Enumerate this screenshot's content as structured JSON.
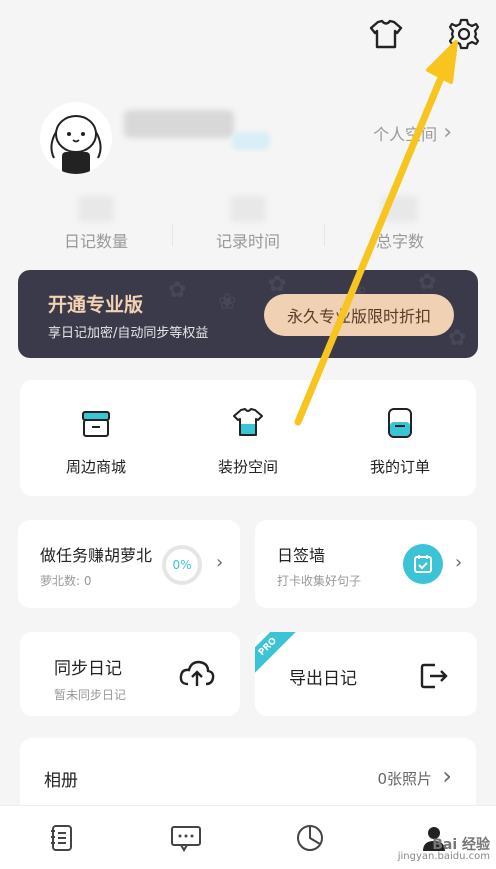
{
  "header": {
    "icons": [
      "shirt-icon",
      "gear-icon"
    ]
  },
  "profile": {
    "space_link": "个人空间",
    "space_chevron": "›"
  },
  "stats": [
    {
      "label": "日记数量"
    },
    {
      "label": "记录时间"
    },
    {
      "label": "总字数"
    }
  ],
  "pro_banner": {
    "title": "开通专业版",
    "subtitle": "享日记加密/自动同步等权益",
    "button": "永久专业版限时折扣"
  },
  "quick_menu": [
    {
      "label": "周边商城",
      "icon": "shop-icon"
    },
    {
      "label": "装扮空间",
      "icon": "shirt-icon"
    },
    {
      "label": "我的订单",
      "icon": "order-icon"
    }
  ],
  "task_card": {
    "title": "做任务赚胡萝北",
    "sub": "萝北数: 0",
    "progress": "0%"
  },
  "sign_card": {
    "title": "日签墙",
    "sub": "打卡收集好句子"
  },
  "sync_card": {
    "title": "同步日记",
    "sub": "暂未同步日记"
  },
  "export_card": {
    "title": "导出日记",
    "badge": "PRO"
  },
  "album": {
    "title": "相册",
    "count": "0张照片"
  },
  "tabbar": [
    "diary-tab-icon",
    "message-tab-icon",
    "stats-tab-icon",
    "profile-tab-icon"
  ],
  "watermark": {
    "name": "Bai 经验",
    "sub": "jingyan.baidu.com"
  },
  "colors": {
    "accent": "#3bc3d6",
    "banner": "#3b3a4b",
    "gold": "#f1d1b3",
    "arrow": "#f7c51e"
  }
}
